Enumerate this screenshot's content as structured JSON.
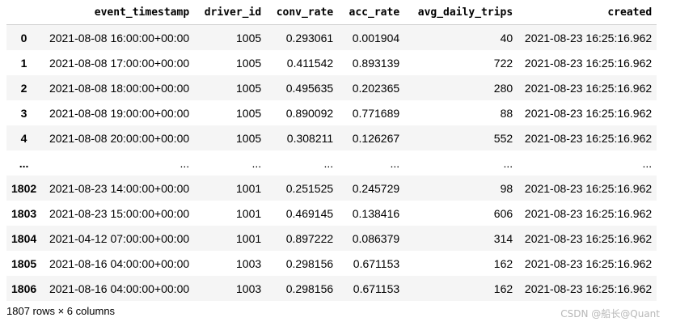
{
  "table": {
    "columns": [
      "",
      "event_timestamp",
      "driver_id",
      "conv_rate",
      "acc_rate",
      "avg_daily_trips",
      "created"
    ],
    "rows": [
      {
        "index": "0",
        "event_timestamp": "2021-08-08 16:00:00+00:00",
        "driver_id": "1005",
        "conv_rate": "0.293061",
        "acc_rate": "0.001904",
        "avg_daily_trips": "40",
        "created": "2021-08-23 16:25:16.962"
      },
      {
        "index": "1",
        "event_timestamp": "2021-08-08 17:00:00+00:00",
        "driver_id": "1005",
        "conv_rate": "0.411542",
        "acc_rate": "0.893139",
        "avg_daily_trips": "722",
        "created": "2021-08-23 16:25:16.962"
      },
      {
        "index": "2",
        "event_timestamp": "2021-08-08 18:00:00+00:00",
        "driver_id": "1005",
        "conv_rate": "0.495635",
        "acc_rate": "0.202365",
        "avg_daily_trips": "280",
        "created": "2021-08-23 16:25:16.962"
      },
      {
        "index": "3",
        "event_timestamp": "2021-08-08 19:00:00+00:00",
        "driver_id": "1005",
        "conv_rate": "0.890092",
        "acc_rate": "0.771689",
        "avg_daily_trips": "88",
        "created": "2021-08-23 16:25:16.962"
      },
      {
        "index": "4",
        "event_timestamp": "2021-08-08 20:00:00+00:00",
        "driver_id": "1005",
        "conv_rate": "0.308211",
        "acc_rate": "0.126267",
        "avg_daily_trips": "552",
        "created": "2021-08-23 16:25:16.962"
      },
      {
        "index": "...",
        "event_timestamp": "...",
        "driver_id": "...",
        "conv_rate": "...",
        "acc_rate": "...",
        "avg_daily_trips": "...",
        "created": "..."
      },
      {
        "index": "1802",
        "event_timestamp": "2021-08-23 14:00:00+00:00",
        "driver_id": "1001",
        "conv_rate": "0.251525",
        "acc_rate": "0.245729",
        "avg_daily_trips": "98",
        "created": "2021-08-23 16:25:16.962"
      },
      {
        "index": "1803",
        "event_timestamp": "2021-08-23 15:00:00+00:00",
        "driver_id": "1001",
        "conv_rate": "0.469145",
        "acc_rate": "0.138416",
        "avg_daily_trips": "606",
        "created": "2021-08-23 16:25:16.962"
      },
      {
        "index": "1804",
        "event_timestamp": "2021-04-12 07:00:00+00:00",
        "driver_id": "1001",
        "conv_rate": "0.897222",
        "acc_rate": "0.086379",
        "avg_daily_trips": "314",
        "created": "2021-08-23 16:25:16.962"
      },
      {
        "index": "1805",
        "event_timestamp": "2021-08-16 04:00:00+00:00",
        "driver_id": "1003",
        "conv_rate": "0.298156",
        "acc_rate": "0.671153",
        "avg_daily_trips": "162",
        "created": "2021-08-23 16:25:16.962"
      },
      {
        "index": "1806",
        "event_timestamp": "2021-08-16 04:00:00+00:00",
        "driver_id": "1003",
        "conv_rate": "0.298156",
        "acc_rate": "0.671153",
        "avg_daily_trips": "162",
        "created": "2021-08-23 16:25:16.962"
      }
    ]
  },
  "footer": {
    "shape_text": "1807 rows × 6 columns"
  },
  "watermark": {
    "text": "CSDN @船长@Quant"
  }
}
